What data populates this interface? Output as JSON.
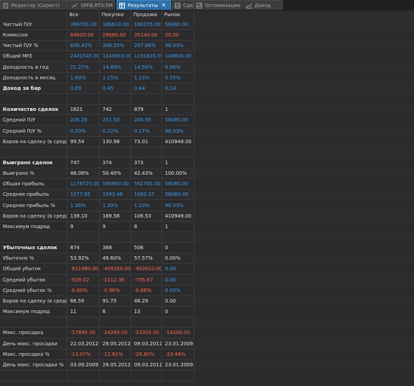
{
  "tabs": [
    {
      "label": "Редактор (Скрипт)",
      "icon": "file-icon",
      "active": false
    },
    {
      "label": "SPFB.RTS:5M",
      "icon": "chart-icon",
      "active": false
    },
    {
      "label": "Результаты",
      "icon": "table-icon",
      "active": true,
      "close": "✕"
    },
    {
      "label": "Сделки",
      "icon": "trades-icon",
      "active": false
    },
    {
      "label": "Оптимизация",
      "icon": "optimization-icon",
      "active": false
    },
    {
      "label": "Доход",
      "icon": "income-chart-icon",
      "active": false
    }
  ],
  "columns": [
    "",
    "Все",
    "Покупки",
    "Продажи",
    "Рынок"
  ],
  "colors": {
    "positive": "#3f9ce8",
    "negative": "#ff6a4a",
    "neutral": "#e6e6e6"
  },
  "rows": [
    {
      "label": "Чистый П/У",
      "bold": false,
      "values": [
        [
          "366765.00",
          "b"
        ],
        [
          "186610.00",
          "b"
        ],
        [
          "180155.00",
          "b"
        ],
        [
          "58080.00",
          "b"
        ]
      ]
    },
    {
      "label": "Комиссия",
      "bold": false,
      "values": [
        [
          "64820.00",
          "r"
        ],
        [
          "29680.00",
          "r"
        ],
        [
          "35140.00",
          "r"
        ],
        [
          "20.00",
          "r"
        ]
      ]
    },
    {
      "label": "Чистый П/У %",
      "bold": false,
      "values": [
        [
          "606.42%",
          "b"
        ],
        [
          "308.55%",
          "b"
        ],
        [
          "297.88%",
          "b"
        ],
        [
          "96.03%",
          "b"
        ]
      ]
    },
    {
      "label": "Общий MFE",
      "bold": false,
      "values": [
        [
          "2441545.00",
          "b"
        ],
        [
          "1249910.00",
          "b"
        ],
        [
          "1191635.00",
          "b"
        ],
        [
          "148800.00",
          "b"
        ]
      ]
    },
    {
      "label": "Доходность в год",
      "bold": false,
      "values": [
        [
          "21.27%",
          "b"
        ],
        [
          "14.89%",
          "b"
        ],
        [
          "14.59%",
          "b"
        ],
        [
          "6.86%",
          "b"
        ]
      ]
    },
    {
      "label": "Доходность в месяц",
      "bold": false,
      "values": [
        [
          "1.60%",
          "b"
        ],
        [
          "1.15%",
          "b"
        ],
        [
          "1.13%",
          "b"
        ],
        [
          "0.55%",
          "b"
        ]
      ]
    },
    {
      "label": "Доход за бар",
      "bold": true,
      "values": [
        [
          "0.89",
          "b"
        ],
        [
          "0.45",
          "b"
        ],
        [
          "0.44",
          "b"
        ],
        [
          "0.14",
          "b"
        ]
      ]
    },
    {
      "label": "",
      "bold": false,
      "values": [
        [
          "",
          ""
        ],
        [
          "",
          ""
        ],
        [
          "",
          ""
        ],
        [
          "",
          ""
        ]
      ]
    },
    {
      "label": "Количество сделок",
      "bold": true,
      "values": [
        [
          "1621",
          "w"
        ],
        [
          "742",
          "w"
        ],
        [
          "879",
          "w"
        ],
        [
          "1",
          "w"
        ]
      ]
    },
    {
      "label": "Средний П/У",
      "bold": false,
      "values": [
        [
          "226.26",
          "b"
        ],
        [
          "251.50",
          "b"
        ],
        [
          "204.95",
          "b"
        ],
        [
          "58080.00",
          "b"
        ]
      ]
    },
    {
      "label": "Средний П/У %",
      "bold": false,
      "values": [
        [
          "0.20%",
          "b"
        ],
        [
          "0.22%",
          "b"
        ],
        [
          "0.17%",
          "b"
        ],
        [
          "96.03%",
          "b"
        ]
      ]
    },
    {
      "label": "Баров на сделку (в среднем)",
      "bold": false,
      "values": [
        [
          "99.54",
          "w"
        ],
        [
          "130.98",
          "w"
        ],
        [
          "73.01",
          "w"
        ],
        [
          "410949.00",
          "w"
        ]
      ]
    },
    {
      "label": "",
      "bold": false,
      "values": [
        [
          "",
          ""
        ],
        [
          "",
          ""
        ],
        [
          "",
          ""
        ],
        [
          "",
          ""
        ]
      ]
    },
    {
      "label": "Выиграно сделок",
      "bold": true,
      "values": [
        [
          "747",
          "w"
        ],
        [
          "374",
          "w"
        ],
        [
          "373",
          "w"
        ],
        [
          "1",
          "w"
        ]
      ]
    },
    {
      "label": "Выиграно %",
      "bold": false,
      "values": [
        [
          "46.08%",
          "w"
        ],
        [
          "50.40%",
          "w"
        ],
        [
          "42.43%",
          "w"
        ],
        [
          "100.00%",
          "w"
        ]
      ]
    },
    {
      "label": "Общая прибыль",
      "bold": false,
      "values": [
        [
          "1178725.00",
          "b"
        ],
        [
          "595960.00",
          "b"
        ],
        [
          "582765.00",
          "b"
        ],
        [
          "58080.00",
          "b"
        ]
      ]
    },
    {
      "label": "Средняя прибыль",
      "bold": false,
      "values": [
        [
          "1577.95",
          "b"
        ],
        [
          "1593.48",
          "b"
        ],
        [
          "1562.37",
          "b"
        ],
        [
          "58080.00",
          "b"
        ]
      ]
    },
    {
      "label": "Средняя прибыль %",
      "bold": false,
      "values": [
        [
          "1.36%",
          "b"
        ],
        [
          "1.39%",
          "b"
        ],
        [
          "1.33%",
          "b"
        ],
        [
          "96.03%",
          "b"
        ]
      ]
    },
    {
      "label": "Баров на сделку (в среднем)",
      "bold": false,
      "values": [
        [
          "138.10",
          "w"
        ],
        [
          "169.58",
          "w"
        ],
        [
          "106.53",
          "w"
        ],
        [
          "410949.00",
          "w"
        ]
      ]
    },
    {
      "label": "Максимум подряд",
      "bold": false,
      "values": [
        [
          "9",
          "w"
        ],
        [
          "9",
          "w"
        ],
        [
          "8",
          "w"
        ],
        [
          "1",
          "w"
        ]
      ]
    },
    {
      "label": "",
      "bold": false,
      "values": [
        [
          "",
          ""
        ],
        [
          "",
          ""
        ],
        [
          "",
          ""
        ],
        [
          "",
          ""
        ]
      ]
    },
    {
      "label": "Убыточных сделок",
      "bold": true,
      "values": [
        [
          "874",
          "w"
        ],
        [
          "368",
          "w"
        ],
        [
          "506",
          "w"
        ],
        [
          "0",
          "w"
        ]
      ]
    },
    {
      "label": "Убыточно %",
      "bold": false,
      "values": [
        [
          "53.92%",
          "w"
        ],
        [
          "49.60%",
          "w"
        ],
        [
          "57.57%",
          "w"
        ],
        [
          "0.00%",
          "w"
        ]
      ]
    },
    {
      "label": "Общий убыток",
      "bold": false,
      "values": [
        [
          "-811960.00",
          "r"
        ],
        [
          "-409350.00",
          "r"
        ],
        [
          "-402610.00",
          "r"
        ],
        [
          "0.00",
          "b"
        ]
      ]
    },
    {
      "label": "Средний убыток",
      "bold": false,
      "values": [
        [
          "-929.02",
          "r"
        ],
        [
          "-1112.36",
          "r"
        ],
        [
          "-795.67",
          "r"
        ],
        [
          "0.00",
          "b"
        ]
      ]
    },
    {
      "label": "Средний убыток %",
      "bold": false,
      "values": [
        [
          "-0.80%",
          "r"
        ],
        [
          "-0.96%",
          "r"
        ],
        [
          "-0.68%",
          "r"
        ],
        [
          "0.00%",
          "b"
        ]
      ]
    },
    {
      "label": "Баров на сделку (в среднем)",
      "bold": false,
      "values": [
        [
          "66.59",
          "w"
        ],
        [
          "91.75",
          "w"
        ],
        [
          "48.29",
          "w"
        ],
        [
          "0.00",
          "w"
        ]
      ]
    },
    {
      "label": "Максимум подряд",
      "bold": false,
      "values": [
        [
          "11",
          "w"
        ],
        [
          "6",
          "w"
        ],
        [
          "13",
          "w"
        ],
        [
          "0",
          "w"
        ]
      ]
    },
    {
      "label": "",
      "bold": false,
      "values": [
        [
          "",
          ""
        ],
        [
          "",
          ""
        ],
        [
          "",
          ""
        ],
        [
          "",
          ""
        ]
      ]
    },
    {
      "label": "Макс. просадка",
      "bold": false,
      "values": [
        [
          "-17895.00",
          "r"
        ],
        [
          "-24265.00",
          "r"
        ],
        [
          "-23305.00",
          "r"
        ],
        [
          "-14200.00",
          "r"
        ]
      ]
    },
    {
      "label": "День макс. просадки",
      "bold": false,
      "values": [
        [
          "22.03.2012",
          "w"
        ],
        [
          "29.05.2012",
          "w"
        ],
        [
          "09.03.2011",
          "w"
        ],
        [
          "23.01.2009",
          "w"
        ]
      ]
    },
    {
      "label": "Макс. просадка %",
      "bold": false,
      "values": [
        [
          "-13.07%",
          "r"
        ],
        [
          "-12.81%",
          "r"
        ],
        [
          "-26.80%",
          "r"
        ],
        [
          "-23.48%",
          "r"
        ]
      ]
    },
    {
      "label": "День макс. просадки %",
      "bold": false,
      "values": [
        [
          "03.09.2009",
          "w"
        ],
        [
          "29.05.2012",
          "w"
        ],
        [
          "09.03.2011",
          "w"
        ],
        [
          "23.01.2009",
          "w"
        ]
      ]
    },
    {
      "label": "",
      "bold": false,
      "values": [
        [
          "",
          ""
        ],
        [
          "",
          ""
        ],
        [
          "",
          ""
        ],
        [
          "",
          ""
        ]
      ]
    }
  ]
}
